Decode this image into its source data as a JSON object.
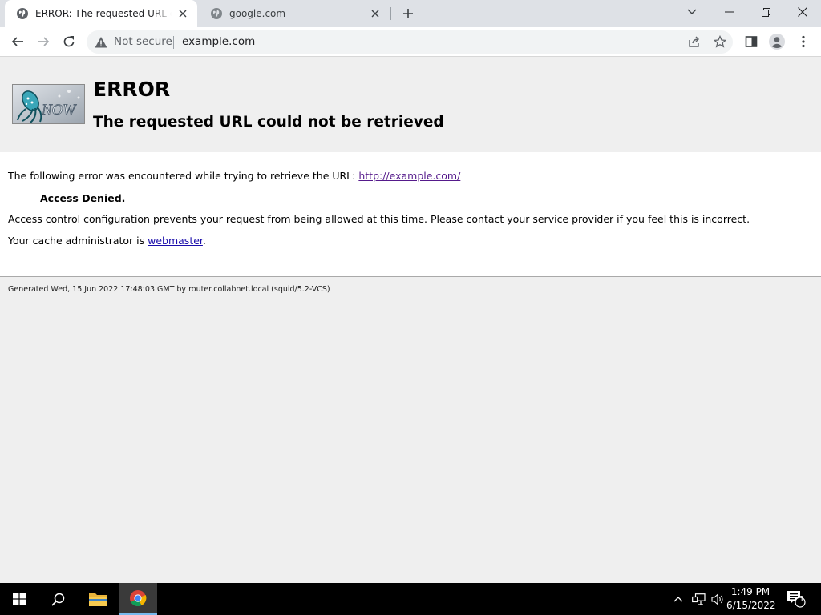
{
  "browser": {
    "tabs": [
      {
        "title": "ERROR: The requested URL could not be retrieved",
        "active": true
      },
      {
        "title": "google.com",
        "active": false
      }
    ],
    "address_bar": {
      "security_label": "Not secure",
      "url": "example.com"
    }
  },
  "page": {
    "title": "ERROR",
    "subtitle": "The requested URL could not be retrieved",
    "intro_text": "The following error was encountered while trying to retrieve the URL: ",
    "error_url": "http://example.com/",
    "denied_label": "Access Denied.",
    "explanation": "Access control configuration prevents your request from being allowed at this time. Please contact your service provider if you feel this is incorrect.",
    "admin_prefix": "Your cache administrator is ",
    "admin_link": "webmaster",
    "admin_suffix": ".",
    "footer": "Generated Wed, 15 Jun 2022 17:48:03 GMT by router.collabnet.local (squid/5.2-VCS)",
    "logo_text": "NOW"
  },
  "taskbar": {
    "time": "1:49 PM",
    "date": "6/15/2022",
    "notification_count": "1"
  },
  "icons": [
    "globe-icon",
    "close-icon",
    "plus-icon",
    "chevron-down-icon",
    "minimize-icon",
    "restore-icon",
    "window-close-icon",
    "back-arrow-icon",
    "forward-arrow-icon",
    "reload-icon",
    "warning-icon",
    "share-icon",
    "star-icon",
    "side-panel-icon",
    "profile-icon",
    "menu-dots-icon",
    "windows-start-icon",
    "search-icon",
    "file-explorer-icon",
    "chrome-icon",
    "chevron-up-icon",
    "network-icon",
    "volume-icon",
    "notification-icon"
  ],
  "colors": {
    "link": "#1a0dab",
    "visited_link": "#551a8b",
    "page_bg": "#efefef",
    "content_bg": "#ffffff"
  }
}
